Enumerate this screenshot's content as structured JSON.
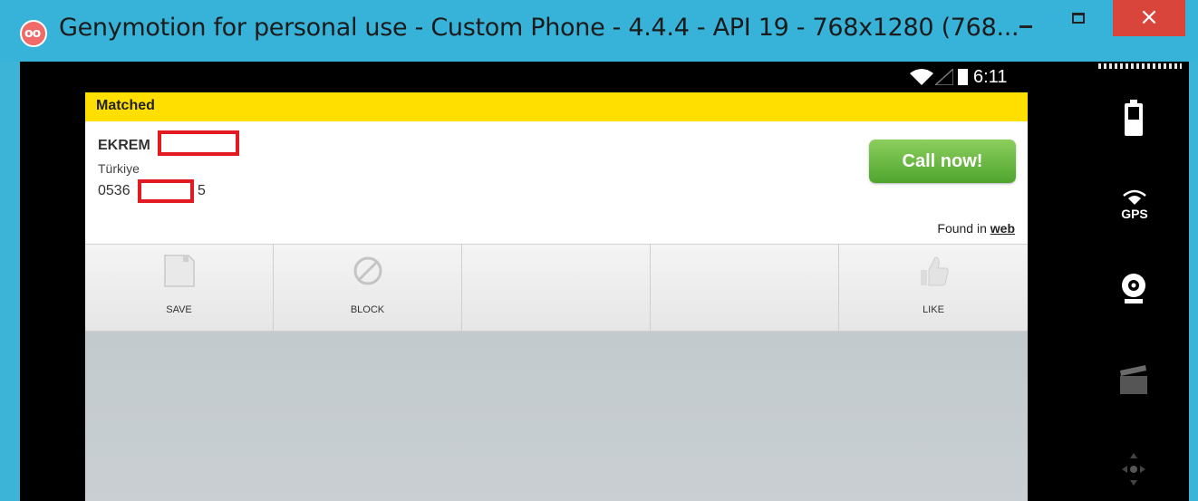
{
  "window": {
    "title": "Genymotion for personal use - Custom Phone - 4.4.4 - API 19 - 768x1280 (768...",
    "app_icon_text": "oo",
    "minimize_label": "–",
    "maximize_label": "",
    "close_label": "×"
  },
  "statusbar": {
    "time": "6:11"
  },
  "caller": {
    "banner": "Matched",
    "name": "EKREM",
    "country": "Türkiye",
    "phone_prefix": "0536",
    "phone_suffix": "5",
    "call_button": "Call now!",
    "found_in_text": "Found in",
    "found_in_link": "web"
  },
  "actions": [
    {
      "label": "SAVE",
      "icon": "save-icon"
    },
    {
      "label": "BLOCK",
      "icon": "block-icon"
    },
    {
      "label": "",
      "icon": ""
    },
    {
      "label": "",
      "icon": ""
    },
    {
      "label": "LIKE",
      "icon": "like-icon"
    }
  ],
  "sidebar_tools": [
    {
      "name": "battery-icon"
    },
    {
      "name": "gps-icon",
      "label": "GPS"
    },
    {
      "name": "webcam-icon"
    },
    {
      "name": "clapperboard-icon"
    },
    {
      "name": "dpad-icon"
    }
  ],
  "colors": {
    "frame": "#37b3d9",
    "close": "#d9453b",
    "banner": "#ffdf00",
    "call_button": "#5cb136",
    "redaction": "#e21b23"
  }
}
